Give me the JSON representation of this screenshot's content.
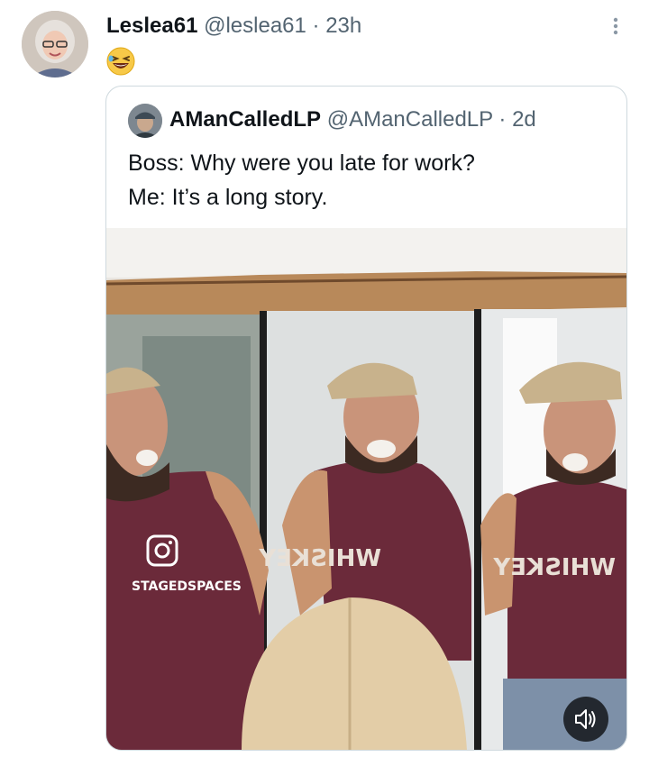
{
  "tweet": {
    "author_name": "Leslea61",
    "author_handle": "@leslea61",
    "separator": "·",
    "time": "23h",
    "body_emoji": "😆",
    "more_icon": "more-vertical-icon",
    "avatar_icon": "profile-photo"
  },
  "quoted": {
    "author_name": "AManCalledLP",
    "author_handle": "@AManCalledLP",
    "separator": "·",
    "time": "2d",
    "lines": [
      "Boss: Why were you late for work?",
      "Me: It’s a long story."
    ],
    "media": {
      "watermark_text": "STAGEDSPACES",
      "shirt_text": "WHISKEY",
      "watermark_icon": "instagram-icon",
      "sound_icon": "speaker-icon"
    }
  }
}
